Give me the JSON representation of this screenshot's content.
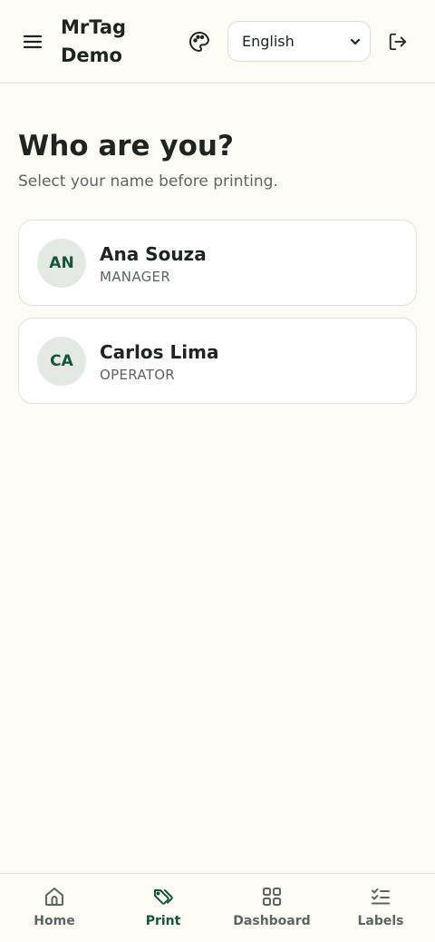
{
  "header": {
    "brand": "MrTag Demo",
    "menu_icon": "hamburger-menu-icon",
    "palette_icon": "palette-icon",
    "language": {
      "selected": "English"
    },
    "logout_icon": "logout-icon"
  },
  "main": {
    "title": "Who are you?",
    "subtitle": "Select your name before printing.",
    "users": [
      {
        "initials": "AN",
        "name": "Ana Souza",
        "role": "MANAGER"
      },
      {
        "initials": "CA",
        "name": "Carlos Lima",
        "role": "OPERATOR"
      }
    ]
  },
  "nav": {
    "items": [
      {
        "label": "Home",
        "icon": "home-icon",
        "active": false
      },
      {
        "label": "Print",
        "icon": "tag-icon",
        "active": true
      },
      {
        "label": "Dashboard",
        "icon": "grid-icon",
        "active": false
      },
      {
        "label": "Labels",
        "icon": "checklist-icon",
        "active": false
      }
    ]
  },
  "colors": {
    "background": "#fdfdf6",
    "accent": "#14563d",
    "avatar_bg": "#e4e9e4"
  }
}
